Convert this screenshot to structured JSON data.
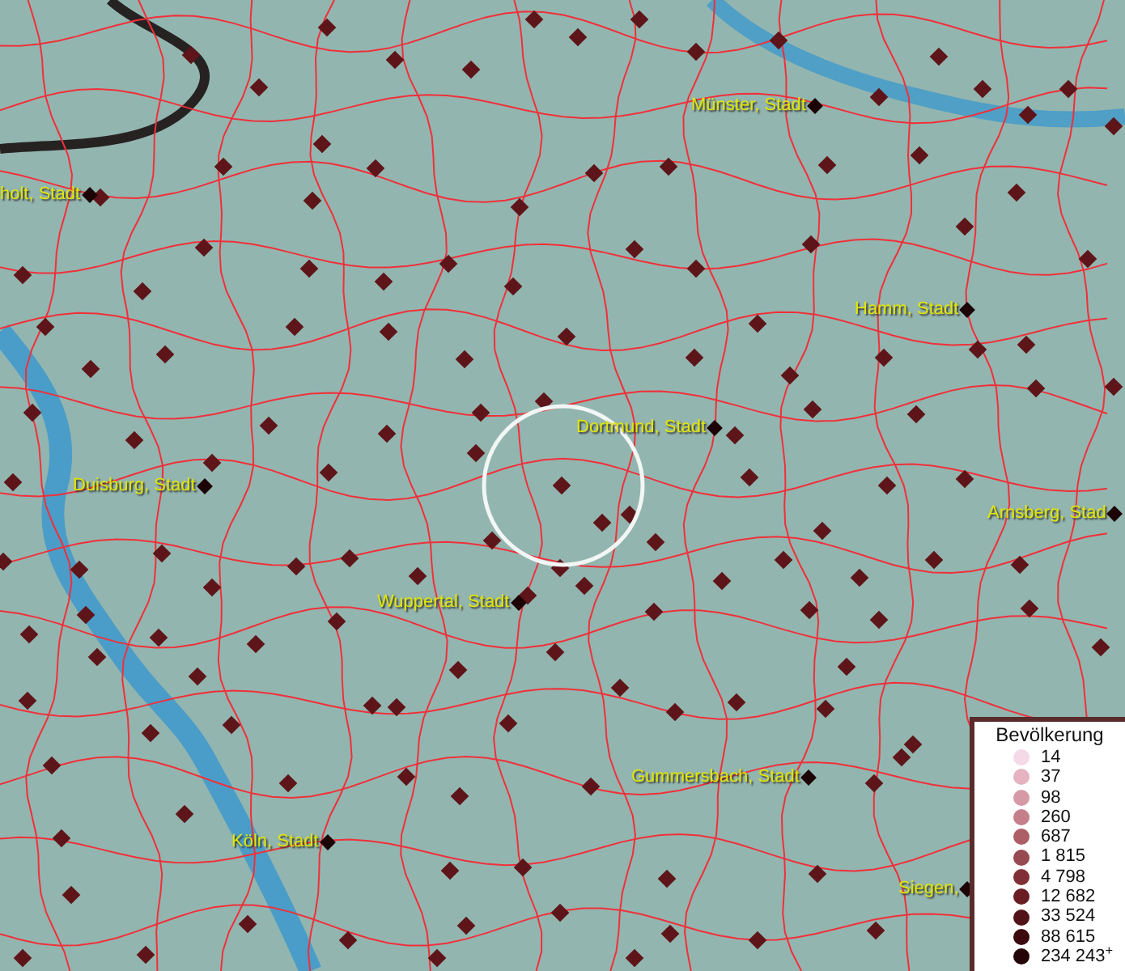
{
  "map": {
    "cities": [
      {
        "label": "holt, Stadt"
      },
      {
        "label": "Münster, Stadt"
      },
      {
        "label": "Hamm, Stadt"
      },
      {
        "label": "Dortmund, Stadt"
      },
      {
        "label": "Duisburg, Stadt"
      },
      {
        "label": "Arnsberg, Stad"
      },
      {
        "label": "Wuppertal, Stadt"
      },
      {
        "label": "Gummersbach, Stadt"
      },
      {
        "label": "Köln, Stadt"
      },
      {
        "label": "Siegen,"
      }
    ]
  },
  "legend": {
    "title": "Bevölkerung",
    "items": [
      {
        "label": "14",
        "color": "#f5d9e6"
      },
      {
        "label": "37",
        "color": "#e6b3c3"
      },
      {
        "label": "98",
        "color": "#d69aa6"
      },
      {
        "label": "260",
        "color": "#c47f8a"
      },
      {
        "label": "687",
        "color": "#ad5e66"
      },
      {
        "label": "1 815",
        "color": "#974a50"
      },
      {
        "label": "4 798",
        "color": "#7f2f35"
      },
      {
        "label": "12 682",
        "color": "#6a1e24"
      },
      {
        "label": "33 524",
        "color": "#521318"
      },
      {
        "label": "88 615",
        "color": "#3c0a0e"
      },
      {
        "label": "234 243$^{+}$",
        "color": "#250407"
      }
    ]
  }
}
